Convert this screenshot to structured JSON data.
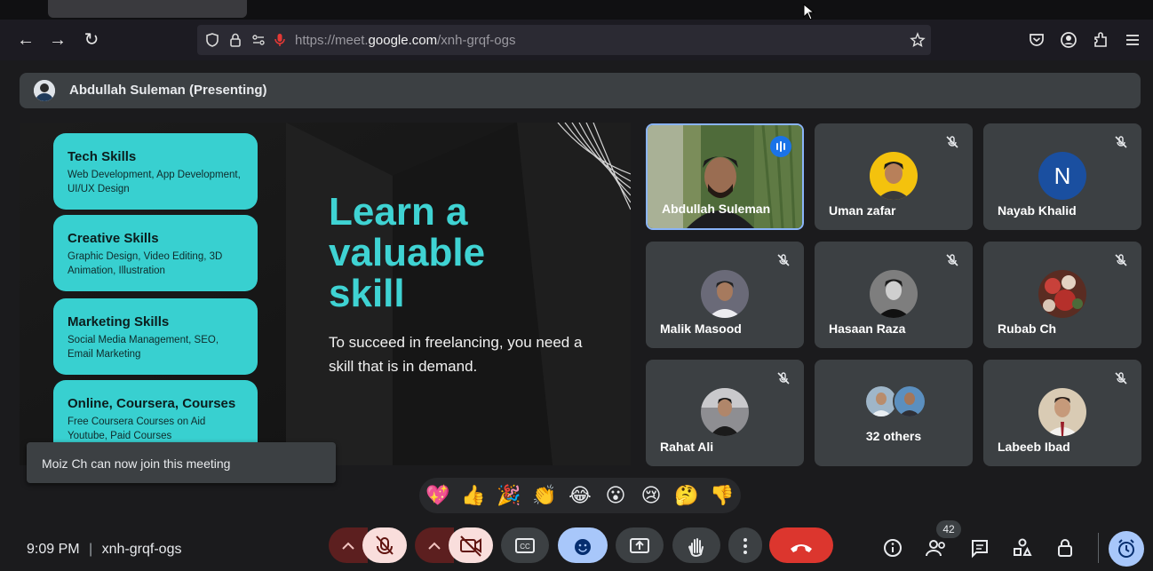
{
  "browser": {
    "url_prefix": "https://meet.",
    "url_host": "google.com",
    "url_path": "/xnh-grqf-ogs",
    "nav": {
      "back": "←",
      "forward": "→",
      "reload": "↻"
    }
  },
  "meet": {
    "presenter_label": "Abdullah Suleman (Presenting)",
    "slide": {
      "skills": [
        {
          "title": "Tech Skills",
          "desc": "Web Development, App Development, UI/UX Design"
        },
        {
          "title": "Creative Skills",
          "desc": "Graphic Design, Video Editing, 3D Animation, Illustration"
        },
        {
          "title": "Marketing Skills",
          "desc": "Social Media Management, SEO, Email Marketing"
        },
        {
          "title": "Online, Coursera, Courses",
          "desc": "Free Coursera Courses on Aid Youtube, Paid Courses"
        }
      ],
      "headline_lines": [
        "Learn a",
        "valuable",
        "skill"
      ],
      "subtext": "To succeed in freelancing, you need a skill that is in demand."
    },
    "participants": [
      {
        "name": "Abdullah Suleman",
        "speaking": true
      },
      {
        "name": "Uman zafar",
        "muted": true
      },
      {
        "name": "Nayab Khalid",
        "initial": "N",
        "muted": true
      },
      {
        "name": "Malik Masood",
        "muted": true
      },
      {
        "name": "Hasaan Raza",
        "muted": true
      },
      {
        "name": "Rubab Ch",
        "muted": true
      },
      {
        "name": "Rahat Ali",
        "muted": true
      },
      {
        "name": "32 others"
      },
      {
        "name": "Labeeb Ibad",
        "muted": true
      }
    ],
    "toast": "Moiz Ch can now join this meeting",
    "reactions": [
      "💖",
      "👍",
      "🎉",
      "👏",
      "😂",
      "😮",
      "😢",
      "🤔",
      "👎"
    ],
    "clock": "9:09 PM",
    "meeting_code": "xnh-grqf-ogs",
    "participant_count": "42"
  },
  "colors": {
    "accent": "#1a73e8",
    "slide_teal": "#38d0d0",
    "end_call": "#ea4335"
  }
}
